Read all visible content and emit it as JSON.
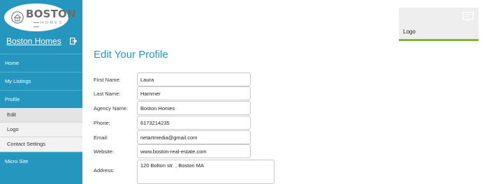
{
  "brand": {
    "logo_word": "BOSTON",
    "logo_sub": "HOMES",
    "name": "Boston Homes"
  },
  "icons": {
    "logout": "logout-icon",
    "logo_badge": "house-badge-icon",
    "logo_tile": "image-placeholder-icon"
  },
  "colors": {
    "sidebar": "#2596be",
    "accent_green": "#7cb82f",
    "title": "#2596be"
  },
  "nav": {
    "home": "Home",
    "my_listings": "My Listings",
    "profile": "Profile",
    "sub": {
      "edit": "Edit",
      "logo": "Logo",
      "contact_settings": "Contact Settings"
    },
    "micro_site": "Micro Site"
  },
  "logo_tile": {
    "label": "Logo"
  },
  "page": {
    "title": "Edit Your Profile"
  },
  "form": {
    "first_name": {
      "label": "First Name:",
      "value": "Laura"
    },
    "last_name": {
      "label": "Last Name:",
      "value": "Hammer"
    },
    "agency_name": {
      "label": "Agency Name:",
      "value": "Boston Homes"
    },
    "phone": {
      "label": "Phone:",
      "value": "6173214235"
    },
    "email": {
      "label": "Email:",
      "value": "netartmedia@gmail.com"
    },
    "website": {
      "label": "Website:",
      "value": "www.boston-real-estate.com"
    },
    "address": {
      "label": "Address:",
      "value": "120 Bolton str. , Boston MA"
    }
  }
}
